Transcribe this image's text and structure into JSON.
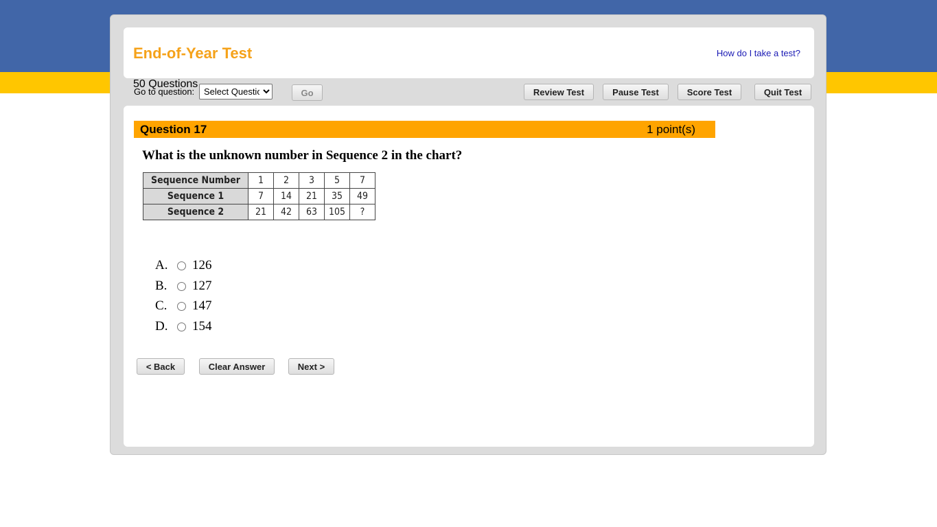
{
  "test": {
    "title": "End-of-Year Test",
    "help_link": "How do I take a test?",
    "question_count": "50 Questions"
  },
  "toolbar": {
    "goto_label": "Go to question:",
    "select_value": "Select Question",
    "go_label": "Go",
    "review_label": "Review Test",
    "pause_label": "Pause Test",
    "score_label": "Score Test",
    "quit_label": "Quit Test"
  },
  "question": {
    "number_label": "Question 17",
    "points": "1 point(s)",
    "text": "What is the unknown number in Sequence 2 in the chart?",
    "table": {
      "rows": [
        {
          "header": "Sequence Number",
          "cells": [
            "1",
            "2",
            "3",
            "5",
            "7"
          ]
        },
        {
          "header": "Sequence 1",
          "cells": [
            "7",
            "14",
            "21",
            "35",
            "49"
          ]
        },
        {
          "header": "Sequence 2",
          "cells": [
            "21",
            "42",
            "63",
            "105",
            "?"
          ]
        }
      ]
    },
    "answers": [
      {
        "letter": "A.",
        "value": "126"
      },
      {
        "letter": "B.",
        "value": "127"
      },
      {
        "letter": "C.",
        "value": "147"
      },
      {
        "letter": "D.",
        "value": "154"
      }
    ]
  },
  "nav": {
    "back_label": "< Back",
    "clear_label": "Clear Answer",
    "next_label": "Next >"
  },
  "colors": {
    "top_band": "#4166a8",
    "accent_band": "#ffc600",
    "title": "#f5a21a",
    "question_bar": "#ffa400"
  }
}
